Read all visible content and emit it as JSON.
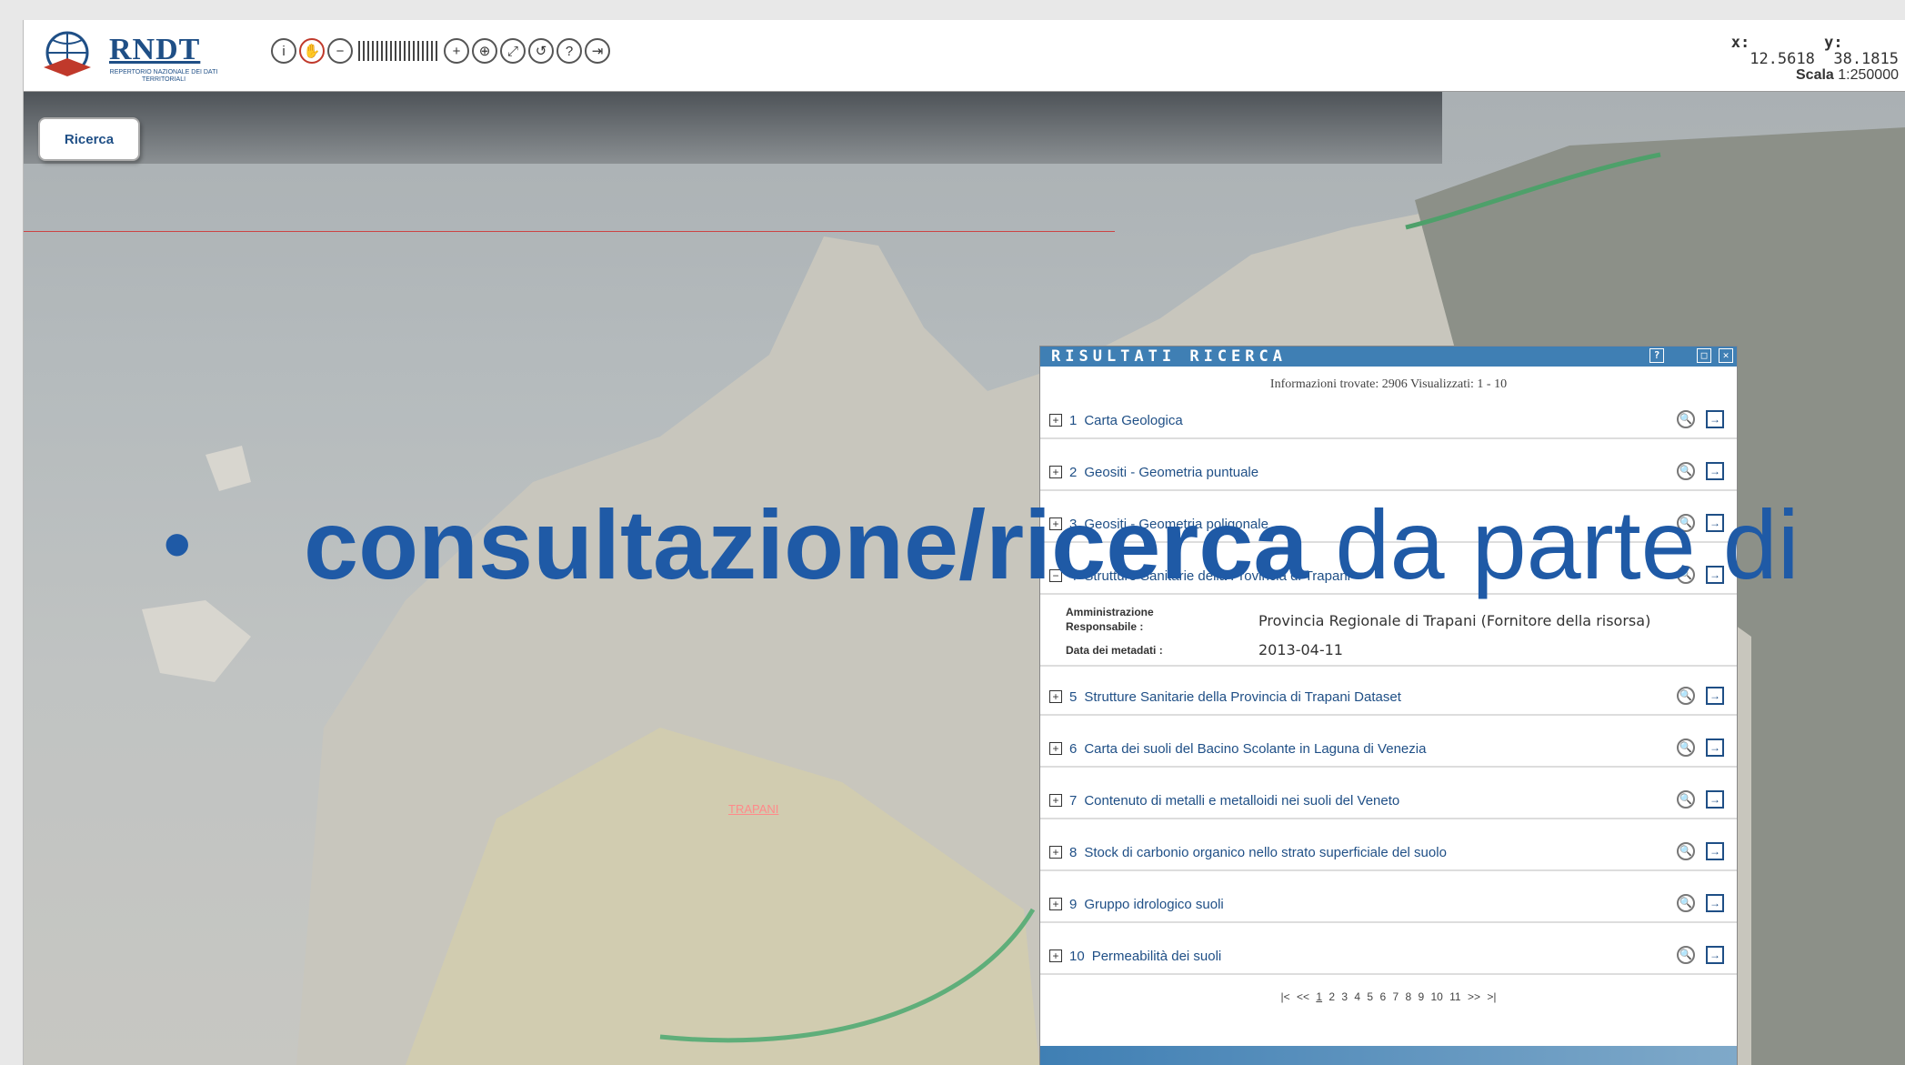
{
  "brand": {
    "name": "RNDT",
    "subtitle": "REPERTORIO NAZIONALE DEI DATI TERRITORIALI"
  },
  "toolbar": {
    "tools": [
      "info-icon",
      "pan-hand-icon",
      "zoom-out-icon",
      "zoom-slider",
      "zoom-in-icon",
      "zoom-box-icon",
      "extent-icon",
      "previous-view-icon",
      "help-icon",
      "exit-icon"
    ]
  },
  "coords": {
    "x_label": "x:",
    "y_label": "y:",
    "x_value": "12.5618",
    "y_value": "38.1815",
    "scale_label": "Scala",
    "scale_value": "1:250000"
  },
  "search_tab": {
    "label": "Ricerca"
  },
  "map": {
    "place_label": "TRAPANI"
  },
  "results": {
    "title": "RISULTATI RICERCA",
    "info": "Informazioni trovate: 2906 Visualizzati: 1 - 10",
    "items": [
      {
        "num": "1",
        "title": "Carta Geologica",
        "expanded": false
      },
      {
        "num": "2",
        "title": "Geositi - Geometria puntuale",
        "expanded": false
      },
      {
        "num": "3",
        "title": "Geositi - Geometria poligonale",
        "expanded": false
      },
      {
        "num": "4",
        "title": "Strutture Sanitarie della Provincia di Trapani",
        "expanded": true
      },
      {
        "num": "5",
        "title": "Strutture Sanitarie della Provincia di Trapani Dataset",
        "expanded": false
      },
      {
        "num": "6",
        "title": "Carta dei suoli del Bacino Scolante in Laguna di Venezia",
        "expanded": false
      },
      {
        "num": "7",
        "title": "Contenuto di metalli e metalloidi nei suoli del Veneto",
        "expanded": false
      },
      {
        "num": "8",
        "title": "Stock di carbonio organico nello strato superficiale del suolo",
        "expanded": false
      },
      {
        "num": "9",
        "title": "Gruppo idrologico suoli",
        "expanded": false
      },
      {
        "num": "10",
        "title": "Permeabilità dei suoli",
        "expanded": false
      }
    ],
    "detail": {
      "resp_label_1": "Amministrazione",
      "resp_label_2": "Responsabile :",
      "resp_value": "Provincia Regionale di Trapani (Fornitore della risorsa)",
      "date_label": "Data dei metadati :",
      "date_value": "2013-04-11"
    },
    "pager": {
      "first": "|<",
      "prev": "<<",
      "current": "1",
      "pages": "2 3 4 5 6 7 8 9 10 11",
      "next": ">>",
      "last": ">|"
    }
  },
  "overlay": {
    "bullet": "•",
    "bold_text": "consultazione/ricerca",
    "rest_text": " da parte di"
  }
}
